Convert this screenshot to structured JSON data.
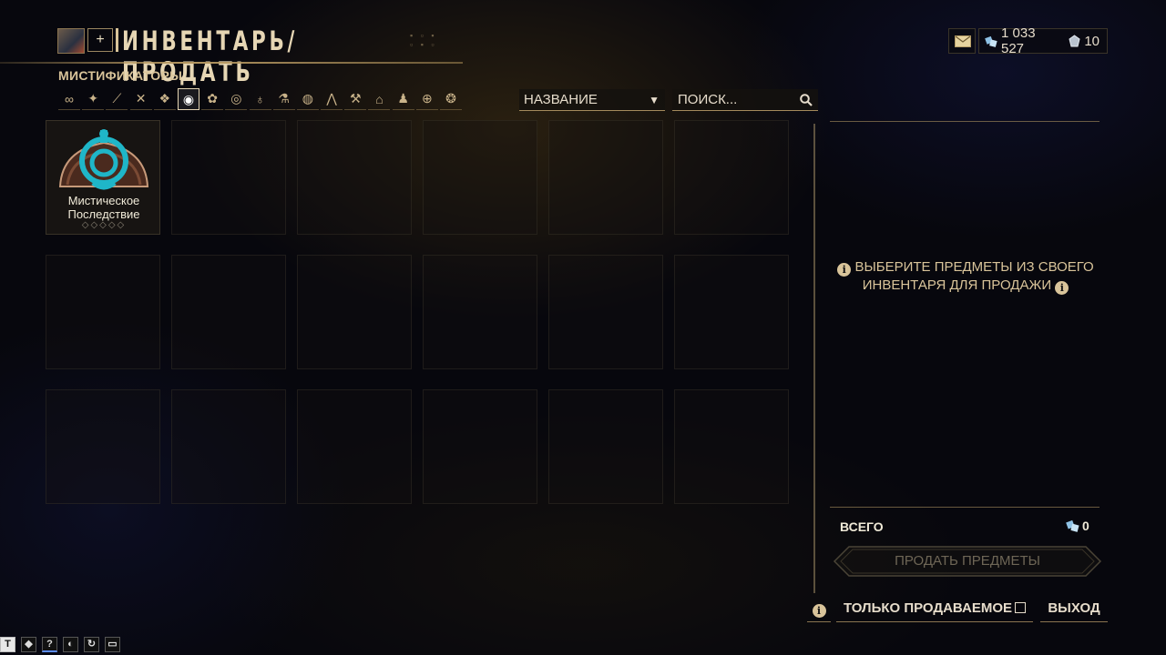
{
  "header": {
    "title": "ИНВЕНТАРЬ/ПРОДАТЬ",
    "plus_label": "+"
  },
  "currency": {
    "credits": "1 033 527",
    "platinum": "10"
  },
  "category": {
    "label": "МИСТИФИКАТОРЫ",
    "filters": [
      {
        "icon": "all-infinity-icon",
        "glyph": "∞"
      },
      {
        "icon": "warframe-icon",
        "glyph": "✦"
      },
      {
        "icon": "primary-weapon-icon",
        "glyph": "⟋"
      },
      {
        "icon": "melee-icon",
        "glyph": "✕"
      },
      {
        "icon": "companion-icon",
        "glyph": "❖"
      },
      {
        "icon": "arcane-icon",
        "glyph": "◉",
        "active": true
      },
      {
        "icon": "flower-icon",
        "glyph": "✿"
      },
      {
        "icon": "gear-ring-icon",
        "glyph": "◎"
      },
      {
        "icon": "key-icon",
        "glyph": "♁"
      },
      {
        "icon": "resource-icon",
        "glyph": "⚗"
      },
      {
        "icon": "mask-icon",
        "glyph": "◍"
      },
      {
        "icon": "wings-icon",
        "glyph": "⋀"
      },
      {
        "icon": "tool-icon",
        "glyph": "⚒"
      },
      {
        "icon": "building-icon",
        "glyph": "⌂"
      },
      {
        "icon": "figure-icon",
        "glyph": "♟"
      },
      {
        "icon": "globe-icon",
        "glyph": "⊕"
      },
      {
        "icon": "gems-icon",
        "glyph": "❂"
      }
    ]
  },
  "sort": {
    "label": "НАЗВАНИЕ",
    "caret": "▼"
  },
  "search": {
    "placeholder": "ПОИСК..."
  },
  "items": [
    {
      "name_line1": "Мистическое",
      "name_line2": "Последствие",
      "rank": "◇◇◇◇◇"
    }
  ],
  "panel": {
    "hint_line1": "ВЫБЕРИТЕ ПРЕДМЕТЫ ИЗ СВОЕГО",
    "hint_line2": "ИНВЕНТАРЯ ДЛЯ ПРОДАЖИ",
    "info_glyph": "i",
    "total_label": "ВСЕГО",
    "total_value": "0",
    "sell_label": "ПРОДАТЬ ПРЕДМЕТЫ"
  },
  "bottom": {
    "only_sellable": "ТОЛЬКО ПРОДАВАЕМОЕ",
    "exit": "ВЫХОД"
  },
  "tray": {
    "t_label": "T",
    "q_label": "?"
  },
  "colors": {
    "accent_gold": "#d9c49a",
    "background": "#07070d",
    "arcane_teal": "#1fb6c8"
  }
}
